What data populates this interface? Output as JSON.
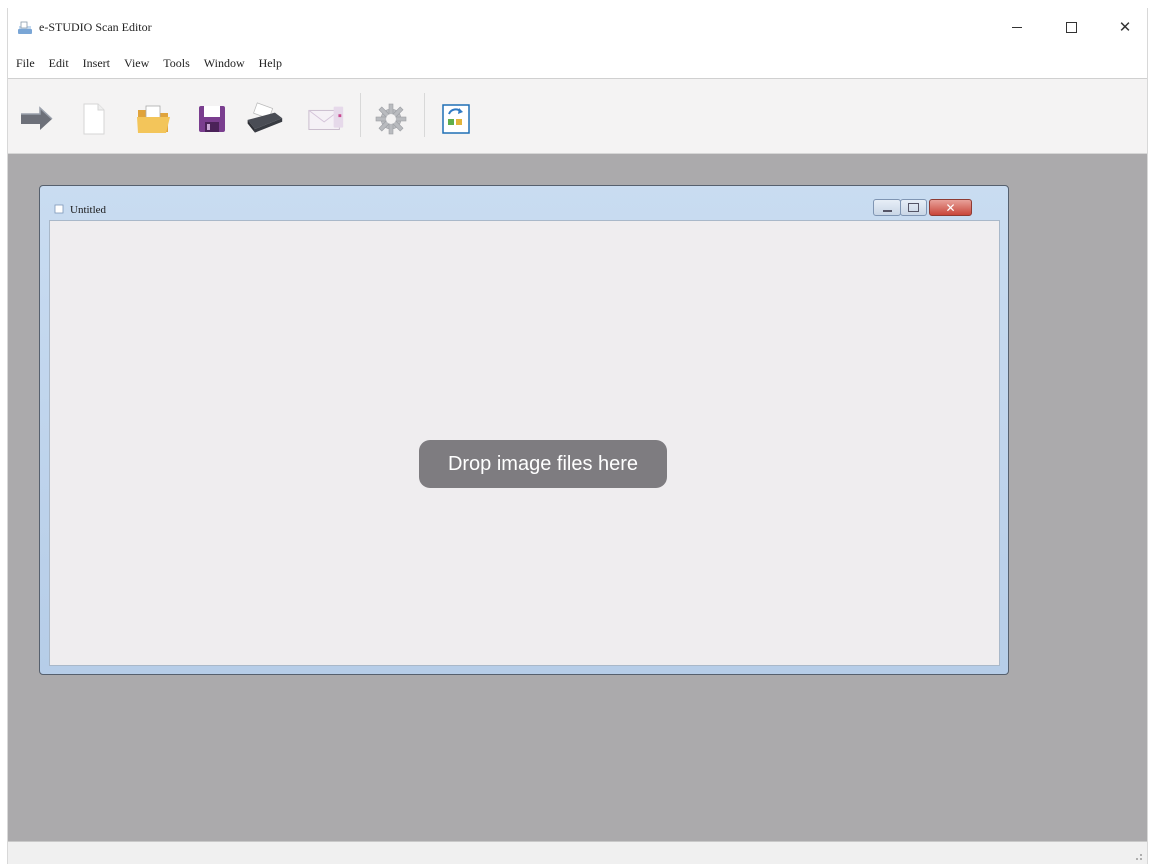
{
  "window": {
    "title": "e-STUDIO Scan Editor",
    "controls": {
      "minimize_icon": "minimize-icon",
      "maximize_icon": "maximize-icon",
      "close_glyph": "✕"
    }
  },
  "menu": {
    "items": [
      "File",
      "Edit",
      "Insert",
      "View",
      "Tools",
      "Window",
      "Help"
    ]
  },
  "toolbar": {
    "buttons": [
      {
        "icon": "scan-icon"
      },
      {
        "icon": "new-document-icon"
      },
      {
        "icon": "open-folder-icon"
      },
      {
        "icon": "save-icon"
      },
      {
        "icon": "print-icon"
      },
      {
        "icon": "email-icon"
      },
      {
        "icon": "settings-gear-icon"
      },
      {
        "icon": "rotate-page-icon"
      }
    ]
  },
  "document_window": {
    "title": "Untitled",
    "close_glyph": "✕",
    "drop_hint": "Drop image files here"
  },
  "colors": {
    "workspace": "#abaaac",
    "drop_hint_bg": "#7e7c80",
    "child_close": "#c9463a"
  }
}
